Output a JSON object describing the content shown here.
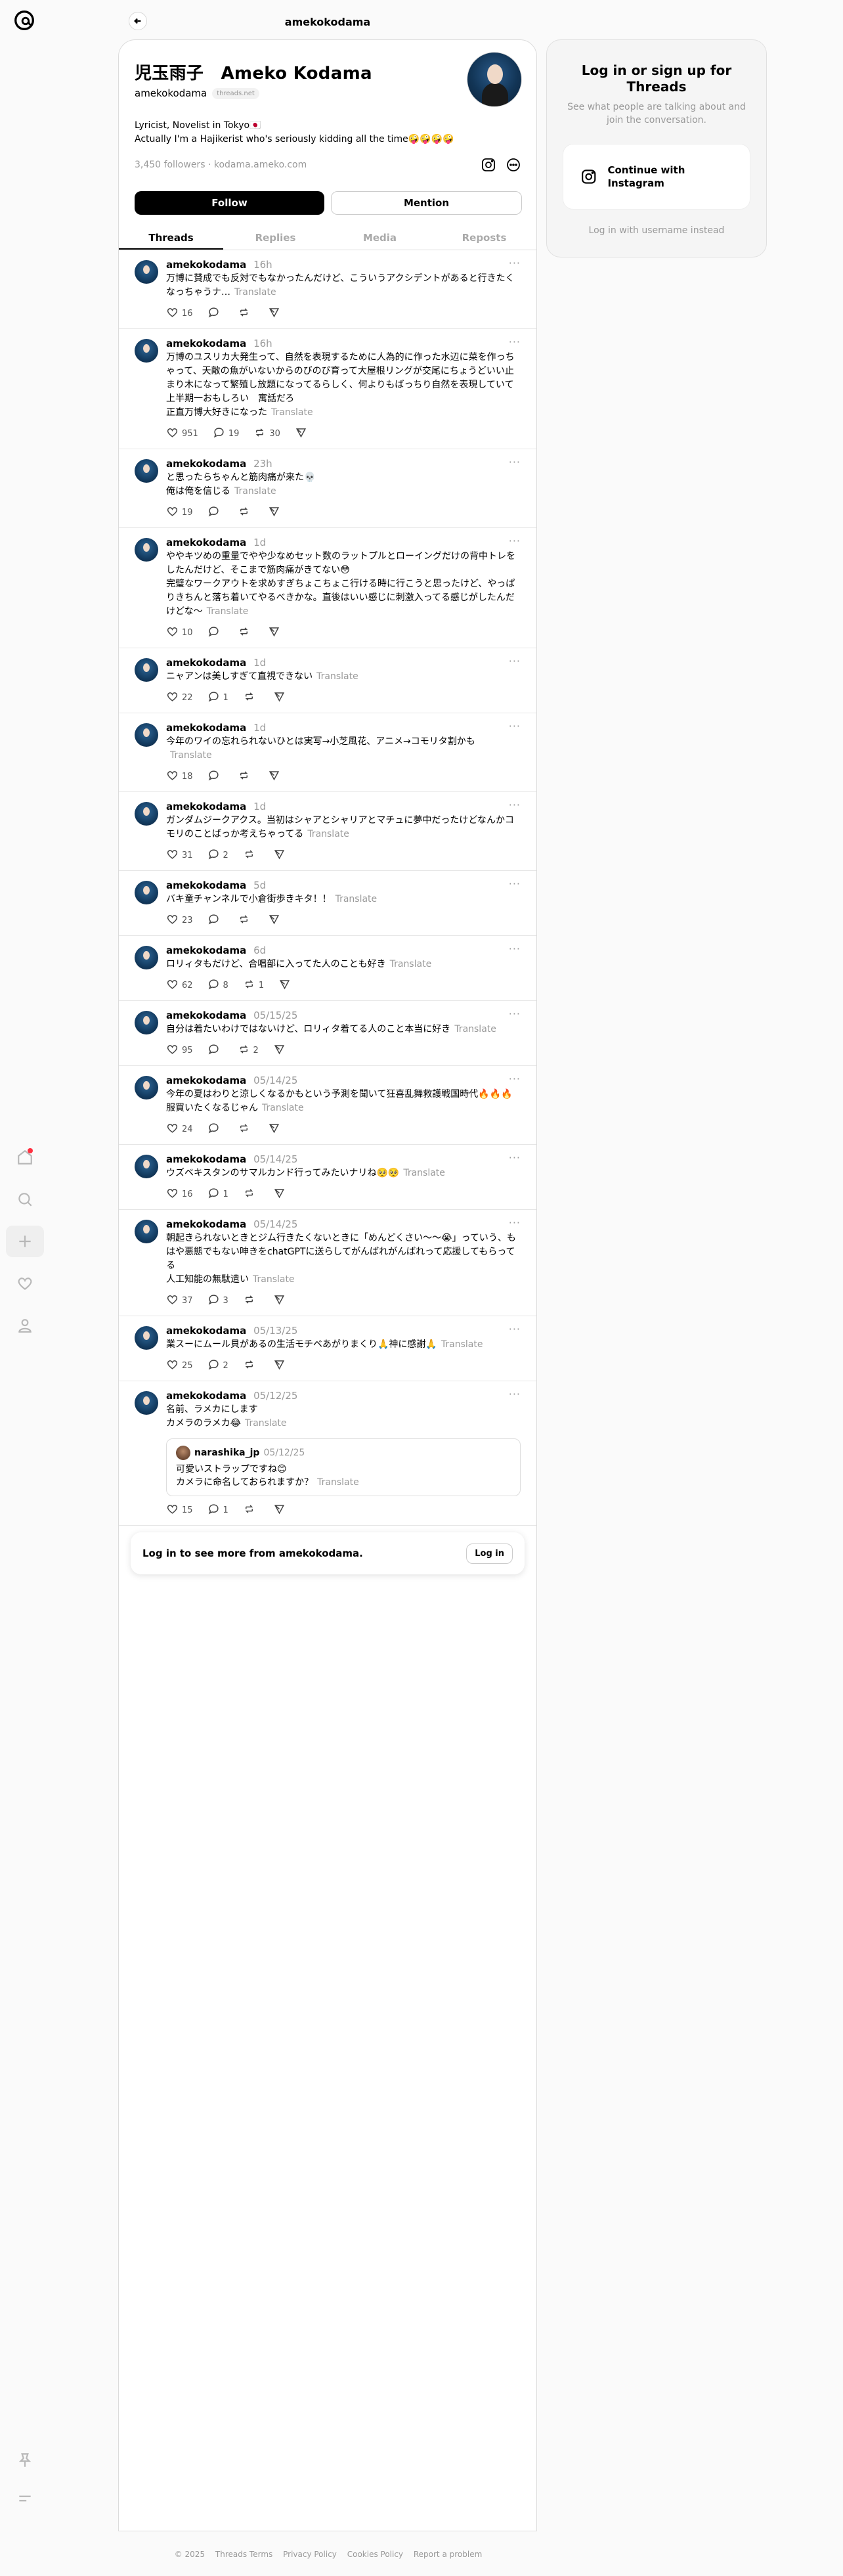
{
  "topbar": {
    "title": "amekokodama"
  },
  "profile": {
    "display_name": "児玉雨子　Ameko Kodama",
    "handle": "amekokodama",
    "domain_badge": "threads.net",
    "bio_line1": "Lyricist, Novelist in Tokyo🇯🇵",
    "bio_line2": "Actually I'm a Hajikerist who's seriously kidding all the time🤪🤪🤪🤪",
    "followers": "3,450 followers",
    "link": "kodama.ameko.com",
    "follow_label": "Follow",
    "mention_label": "Mention"
  },
  "tabs": [
    "Threads",
    "Replies",
    "Media",
    "Reposts"
  ],
  "posts": [
    {
      "user": "amekokodama",
      "time": "16h",
      "text": "万博に賛成でも反対でもなかったんだけど、こういうアクシデントがあると行きたくなっちゃうナ…",
      "translate": "Translate",
      "likes": "16",
      "replies": "",
      "reposts": ""
    },
    {
      "user": "amekokodama",
      "time": "16h",
      "text": "万博のユスリカ大発生って、自然を表現するために人為的に作った水辺に菜を作っちゃって、天敵の魚がいないからのびのび育って大屋根リングが交尾にちょうどいい止まり木になって繁殖し放題になってるらしく、何よりもばっちり自然を表現していて上半期一おもしろい　寓話だろ\n正直万博大好きになった",
      "translate": "Translate",
      "likes": "951",
      "replies": "19",
      "reposts": "30"
    },
    {
      "user": "amekokodama",
      "time": "23h",
      "text": "と思ったらちゃんと筋肉痛が来た💀\n俺は俺を信じる",
      "translate": "Translate",
      "likes": "19",
      "replies": "",
      "reposts": ""
    },
    {
      "user": "amekokodama",
      "time": "1d",
      "text": "ややキツめの重量でやや少なめセット数のラットプルとローイングだけの背中トレをしたんだけど、そこまで筋肉痛がきてない😳\n完璧なワークアウトを求めすぎちょこちょこ行ける時に行こうと思ったけど、やっぱりきちんと落ち着いてやるべきかな。直後はいい感じに刺激入ってる感じがしたんだけどな～",
      "translate": "Translate",
      "likes": "10",
      "replies": "",
      "reposts": ""
    },
    {
      "user": "amekokodama",
      "time": "1d",
      "text": "ニャアンは美しすぎて直視できない",
      "translate": "Translate",
      "likes": "22",
      "replies": "1",
      "reposts": ""
    },
    {
      "user": "amekokodama",
      "time": "1d",
      "text": "今年のワイの忘れられないひとは実写→小芝風花、アニメ→コモリタ割かも",
      "translate": "Translate",
      "likes": "18",
      "replies": "",
      "reposts": ""
    },
    {
      "user": "amekokodama",
      "time": "1d",
      "text": "ガンダムジークアクス。当初はシャアとシャリアとマチュに夢中だったけどなんかコモリのことばっか考えちゃってる",
      "translate": "Translate",
      "likes": "31",
      "replies": "2",
      "reposts": ""
    },
    {
      "user": "amekokodama",
      "time": "5d",
      "text": "バキ童チャンネルで小倉街歩きキタ！！",
      "translate": "Translate",
      "likes": "23",
      "replies": "",
      "reposts": ""
    },
    {
      "user": "amekokodama",
      "time": "6d",
      "text": "ロリィタもだけど、合唱部に入ってた人のことも好き",
      "translate": "Translate",
      "likes": "62",
      "replies": "8",
      "reposts": "1"
    },
    {
      "user": "amekokodama",
      "time": "05/15/25",
      "text": "自分は着たいわけではないけど、ロリィタ着てる人のこと本当に好き",
      "translate": "Translate",
      "likes": "95",
      "replies": "",
      "reposts": "2"
    },
    {
      "user": "amekokodama",
      "time": "05/14/25",
      "text": "今年の夏はわりと涼しくなるかもという予測を聞いて狂喜乱舞救護戦国時代🔥🔥🔥服買いたくなるじゃん",
      "translate": "Translate",
      "likes": "24",
      "replies": "",
      "reposts": ""
    },
    {
      "user": "amekokodama",
      "time": "05/14/25",
      "text": "ウズベキスタンのサマルカンド行ってみたいナリね🥺🥺",
      "translate": "Translate",
      "likes": "16",
      "replies": "1",
      "reposts": ""
    },
    {
      "user": "amekokodama",
      "time": "05/14/25",
      "text": "朝起きられないときとジム行きたくないときに「めんどくさい〜〜😭」っていう、もはや悪態でもない呻きをchatGPTに送らしてがんばれがんばれって応援してもらってる\n人工知能の無駄遣い",
      "translate": "Translate",
      "likes": "37",
      "replies": "3",
      "reposts": ""
    },
    {
      "user": "amekokodama",
      "time": "05/13/25",
      "text": "業スーにムール貝があるの生活モチベあがりまくり🙏神に感謝🙏",
      "translate": "Translate",
      "likes": "25",
      "replies": "2",
      "reposts": ""
    },
    {
      "user": "amekokodama",
      "time": "05/12/25",
      "text": "名前、ラメカにします\nカメラのラメカ😂",
      "translate": "Translate",
      "likes": "15",
      "replies": "1",
      "reposts": "",
      "quote": {
        "user": "narashika_jp",
        "time": "05/12/25",
        "text": "可愛いストラップですね😊\nカメラに命名しておられますか？",
        "translate": "Translate"
      }
    }
  ],
  "login_more": {
    "text": "Log in to see more from amekokodama.",
    "button": "Log in"
  },
  "side": {
    "heading": "Log in or sign up for Threads",
    "sub": "See what people are talking about and join the conversation.",
    "ig_button": "Continue with Instagram",
    "alt_login": "Log in with username instead"
  },
  "footer": [
    "© 2025",
    "Threads Terms",
    "Privacy Policy",
    "Cookies Policy",
    "Report a problem"
  ],
  "icons": {
    "logo": "threads-logo",
    "home": "home-icon",
    "search": "search-icon",
    "create": "plus-icon",
    "activity": "heart-icon",
    "profile": "user-icon",
    "pin": "pin-icon",
    "menu": "menu-icon"
  }
}
